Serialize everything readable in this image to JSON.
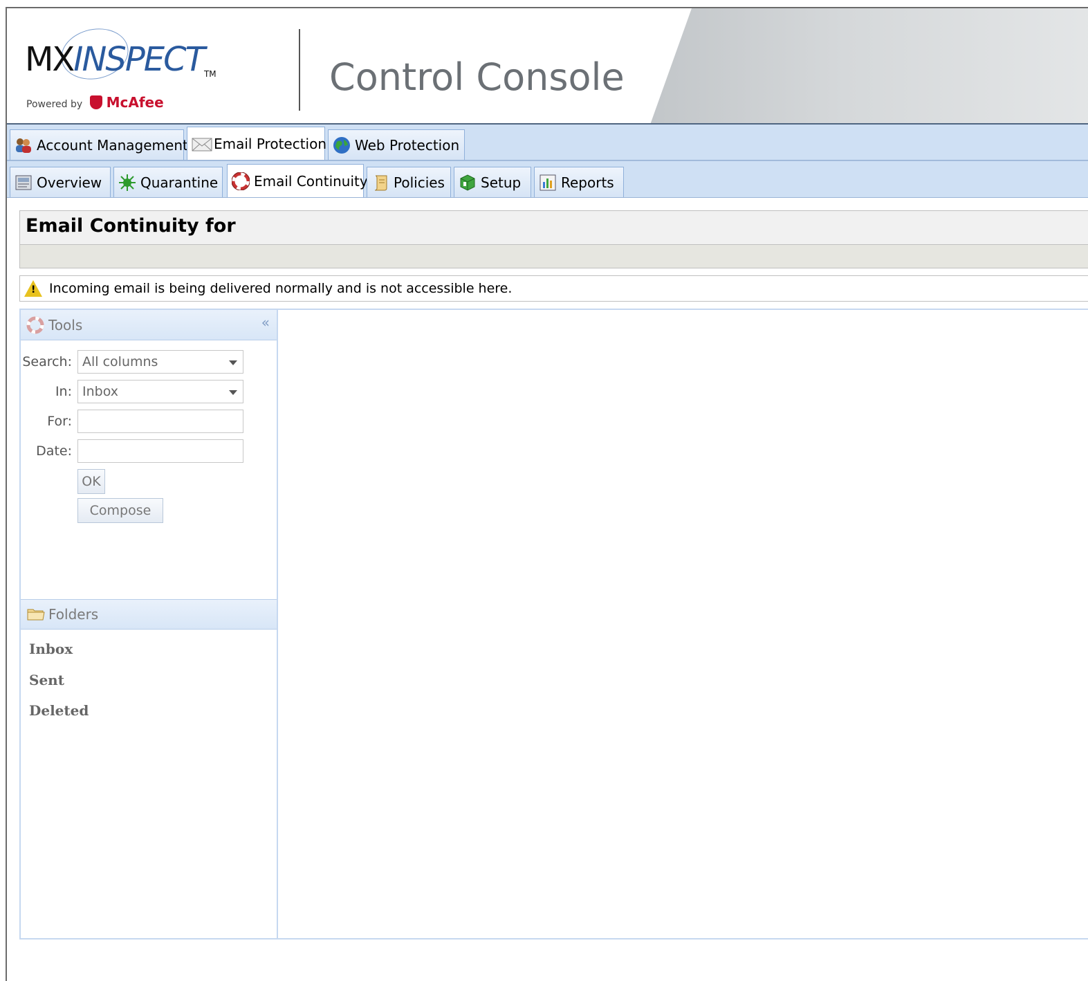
{
  "header": {
    "logo_mx": "MX",
    "logo_inspect": "INSPECT",
    "logo_tm": "TM",
    "powered_by": "Powered by",
    "powered_brand": "McAfee",
    "title": "Control Console"
  },
  "main_tabs": [
    {
      "label": "Account Management",
      "icon": "users-icon"
    },
    {
      "label": "Email Protection",
      "icon": "envelope-icon",
      "active": true
    },
    {
      "label": "Web Protection",
      "icon": "globe-icon"
    }
  ],
  "sub_tabs": [
    {
      "label": "Overview",
      "icon": "overview-icon"
    },
    {
      "label": "Quarantine",
      "icon": "quarantine-icon"
    },
    {
      "label": "Email Continuity",
      "icon": "lifebuoy-icon",
      "active": true
    },
    {
      "label": "Policies",
      "icon": "scroll-icon"
    },
    {
      "label": "Setup",
      "icon": "setup-icon"
    },
    {
      "label": "Reports",
      "icon": "chart-icon"
    }
  ],
  "page": {
    "title": "Email Continuity for",
    "notice": "Incoming email is being delivered normally and is not accessible here."
  },
  "tools": {
    "title": "Tools",
    "collapse": "«",
    "search_label": "Search:",
    "search_value": "All columns",
    "in_label": "In:",
    "in_value": "Inbox",
    "for_label": "For:",
    "for_value": "",
    "date_label": "Date:",
    "date_value": "",
    "ok_label": "OK",
    "compose_label": "Compose"
  },
  "folders": {
    "title": "Folders",
    "items": [
      "Inbox",
      "Sent",
      "Deleted"
    ]
  },
  "colors": {
    "tab_bar": "#cfe0f4",
    "brand_red": "#c8102e",
    "warning": "#e8c21f"
  }
}
